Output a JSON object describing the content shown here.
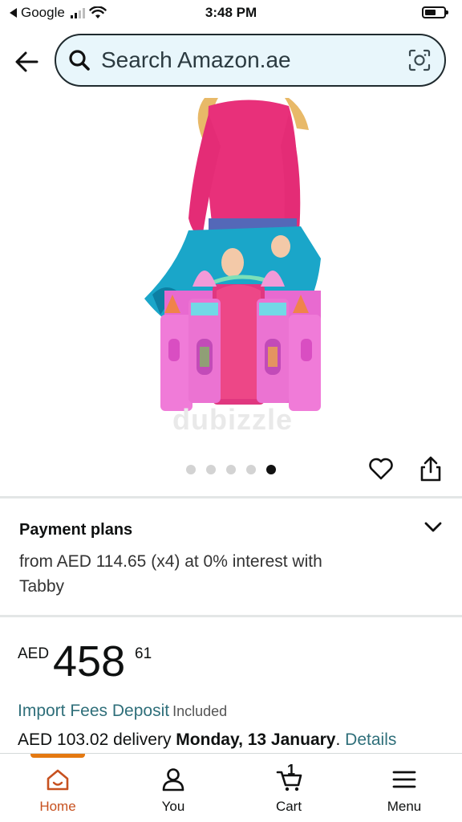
{
  "status_bar": {
    "back_app": "Google",
    "time": "3:48 PM"
  },
  "header": {
    "back_icon": "back-arrow-icon",
    "search_placeholder": "Search Amazon.ae",
    "search_icon": "search-icon",
    "camera_icon": "camera-lens-icon"
  },
  "product": {
    "watermark": "dubizzle",
    "image_count": 5,
    "active_image": 5,
    "wishlist_icon": "heart-icon",
    "share_icon": "share-icon"
  },
  "payment_plans": {
    "title": "Payment plans",
    "text": "from AED 114.65 (x4) at 0% interest with Tabby"
  },
  "price": {
    "currency": "AED",
    "whole": "458",
    "fraction": "61"
  },
  "import_fees": {
    "link": "Import Fees Deposit",
    "status": "Included"
  },
  "delivery": {
    "prefix": "AED 103.02 delivery",
    "date": "Monday, 13 January",
    "suffix": ".",
    "details_link": "Details"
  },
  "bottom_nav": {
    "items": [
      {
        "label": "Home",
        "icon": "home-icon"
      },
      {
        "label": "You",
        "icon": "person-icon"
      },
      {
        "label": "Cart",
        "icon": "cart-icon"
      },
      {
        "label": "Menu",
        "icon": "menu-icon"
      }
    ],
    "cart_count": "1"
  },
  "colors": {
    "accent_orange": "#e47911",
    "link_teal": "#2f6f7a",
    "search_bg": "#e8f6fb"
  }
}
